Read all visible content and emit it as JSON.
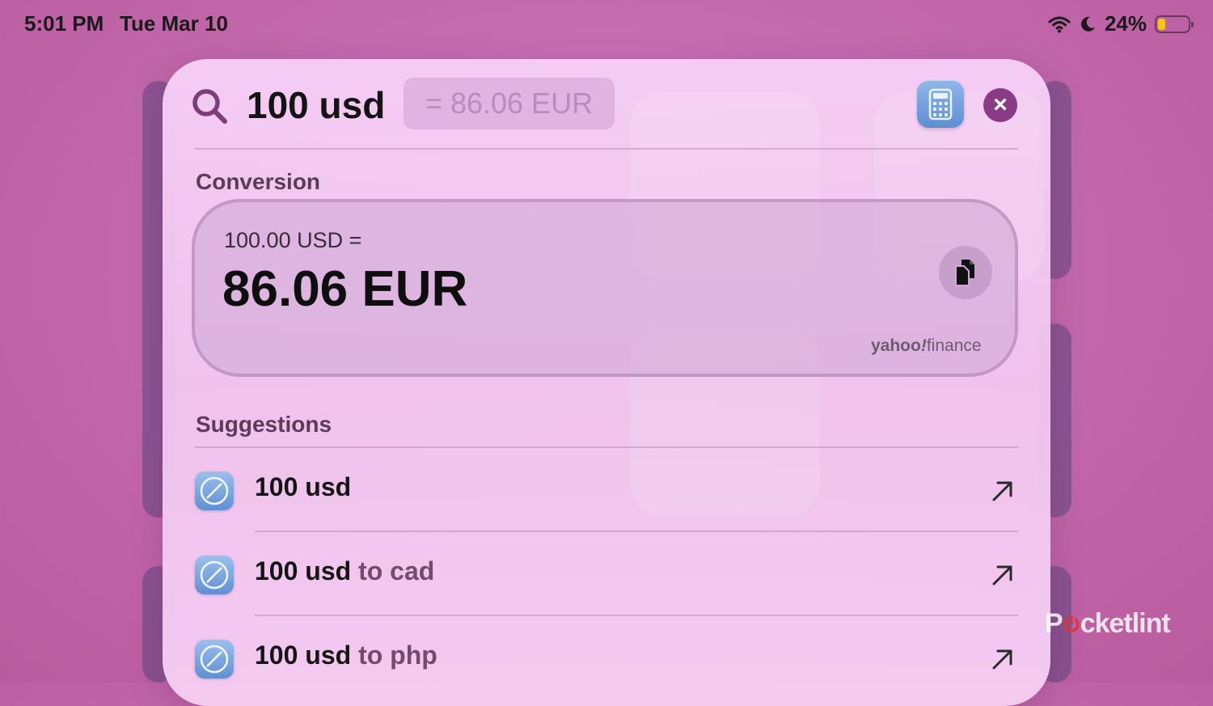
{
  "status_bar": {
    "time": "5:01 PM",
    "date": "Tue Mar 10",
    "battery_percent": "24%",
    "battery_level": 0.24,
    "icons": [
      "wifi-icon",
      "moon-icon",
      "battery-icon"
    ]
  },
  "search": {
    "query": "100 usd",
    "inline_result": "= 86.06 EUR",
    "icons": [
      "search-icon",
      "calculator-icon",
      "close-icon"
    ]
  },
  "conversion": {
    "section_title": "Conversion",
    "from_text": "100.00 USD =",
    "result_text": "86.06 EUR",
    "provider_left": "yahoo",
    "provider_mark": "!",
    "provider_right": "finance",
    "copy_icon": "copy-icon"
  },
  "suggestions": {
    "section_title": "Suggestions",
    "items": [
      {
        "query": "100 usd",
        "extra": ""
      },
      {
        "query": "100 usd",
        "extra": " to cad"
      },
      {
        "query": "100 usd",
        "extra": " to php"
      }
    ],
    "row_icons": [
      "safari-icon",
      "arrow-up-right-icon"
    ]
  },
  "watermark": {
    "left": "P",
    "right": "cketlint",
    "mark_color": "#e0322f"
  },
  "colors": {
    "background": "#c46aae",
    "close_button": "#8a3b86",
    "accent_text": "#714b70"
  }
}
